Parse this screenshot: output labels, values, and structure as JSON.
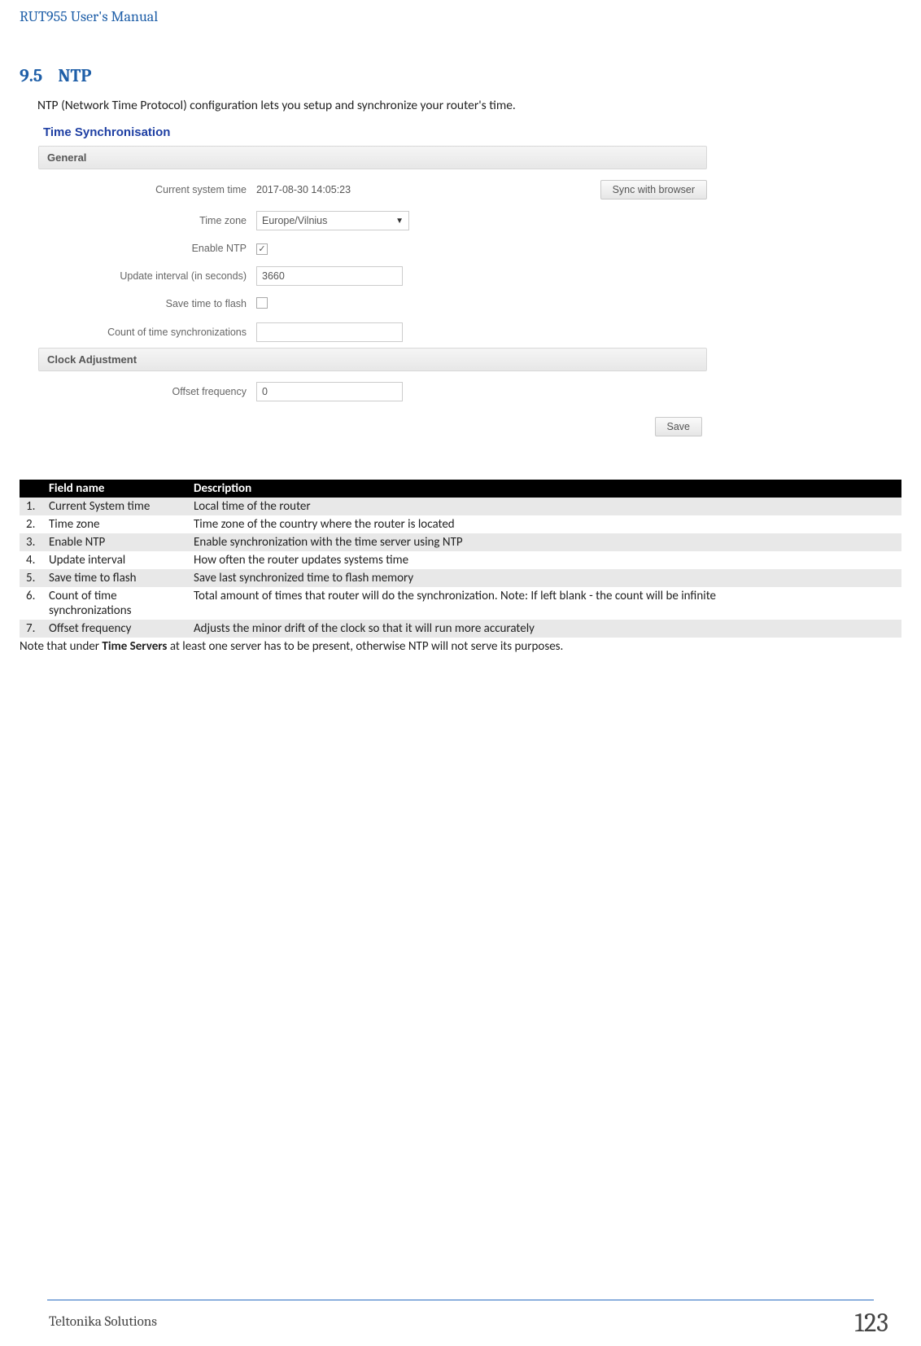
{
  "header": {
    "title": "RUT955 User's Manual"
  },
  "section": {
    "number": "9.5",
    "title": "NTP"
  },
  "intro": "NTP (Network Time Protocol) configuration lets you setup and synchronize your router's time.",
  "screenshot": {
    "title": "Time Synchronisation",
    "general_label": "General",
    "clock_label": "Clock Adjustment",
    "rows": {
      "current_time_label": "Current system time",
      "current_time_value": "2017-08-30 14:05:23",
      "sync_button": "Sync with browser",
      "timezone_label": "Time zone",
      "timezone_value": "Europe/Vilnius",
      "enable_ntp_label": "Enable NTP",
      "enable_ntp_checked": "✓",
      "update_interval_label": "Update interval (in seconds)",
      "update_interval_value": "3660",
      "save_flash_label": "Save time to flash",
      "count_sync_label": "Count of time synchronizations",
      "count_sync_value": "",
      "offset_label": "Offset frequency",
      "offset_value": "0"
    },
    "save_button": "Save"
  },
  "table": {
    "head_field": "Field name",
    "head_desc": "Description",
    "rows": [
      {
        "n": "1.",
        "name": "Current System time",
        "desc": "Local time of the router"
      },
      {
        "n": "2.",
        "name": "Time zone",
        "desc": "Time zone of the country where the router is located"
      },
      {
        "n": "3.",
        "name": "Enable NTP",
        "desc": "Enable synchronization with the time server using NTP"
      },
      {
        "n": "4.",
        "name": "Update interval",
        "desc": "How often the router updates systems time"
      },
      {
        "n": "5.",
        "name": "Save time to flash",
        "desc": "Save last synchronized time to flash memory"
      },
      {
        "n": "6.",
        "name": "Count of time synchronizations",
        "desc": "Total amount of times that router will do the synchronization. Note: If left blank - the count will be infinite"
      },
      {
        "n": "7.",
        "name": "Offset frequency",
        "desc": "Adjusts the minor drift of the clock so that it will run more accurately"
      }
    ]
  },
  "note_pre": "Note that under ",
  "note_bold": "Time Servers",
  "note_post": " at least one server has to be present, otherwise NTP will not serve its purposes.",
  "footer": {
    "left": "Teltonika Solutions",
    "page": "123"
  }
}
